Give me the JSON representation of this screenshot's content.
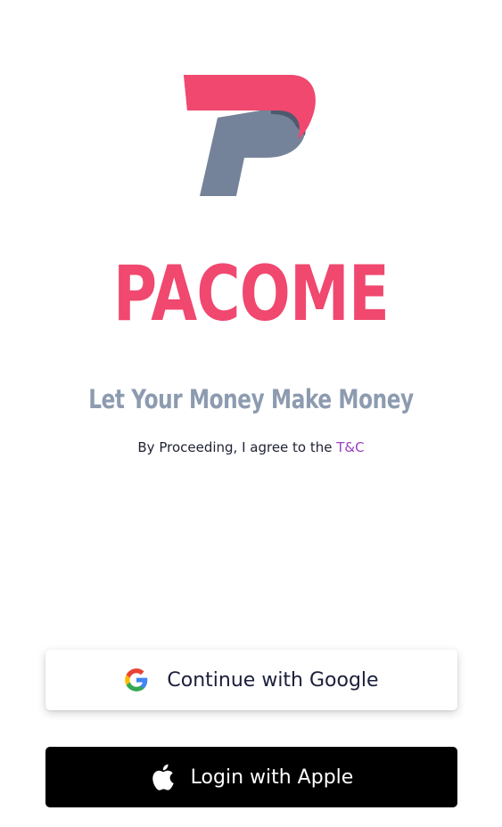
{
  "brand": {
    "name": "PACOME",
    "tagline": "Let Your Money Make Money",
    "logo_icon": "pacome-p-logo",
    "primary_color": "#f0486f",
    "secondary_color": "#75839a"
  },
  "terms": {
    "prefix": "By Proceeding, I agree to the ",
    "link_label": "T&C",
    "link_color": "#9a3fc4"
  },
  "auth": {
    "google": {
      "label": "Continue with Google",
      "icon": "google-icon"
    },
    "apple": {
      "label": "Login with Apple",
      "icon": "apple-icon"
    }
  }
}
